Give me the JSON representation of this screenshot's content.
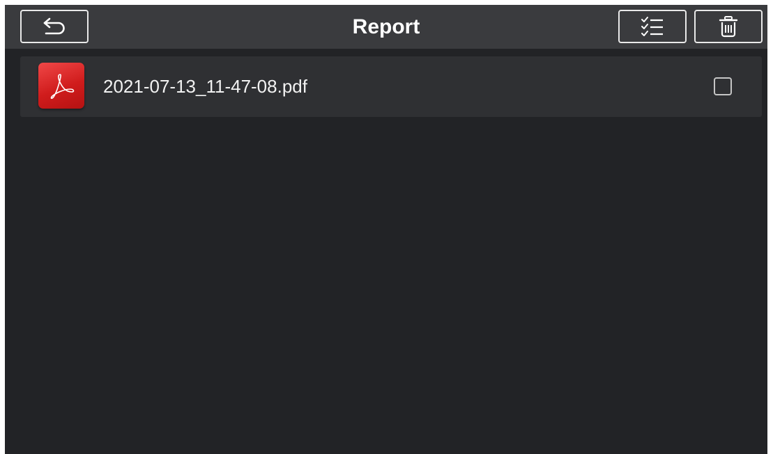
{
  "header": {
    "title": "Report",
    "back_icon": "back-arrow-icon",
    "select_icon": "checklist-icon",
    "delete_icon": "trash-icon"
  },
  "files": [
    {
      "name": "2021-07-13_11-47-08.pdf",
      "icon": "pdf-icon",
      "checked": false
    }
  ],
  "colors": {
    "background": "#222326",
    "topbar": "#3a3b3e",
    "row": "#2f3033",
    "pdf_red": "#d01c1c"
  }
}
